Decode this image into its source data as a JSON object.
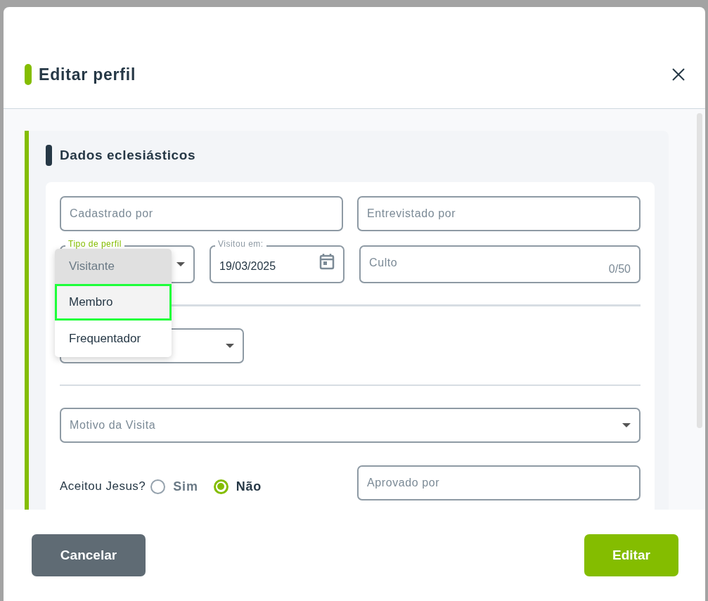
{
  "window": {
    "title": "Editar perfil"
  },
  "section": {
    "title": "Dados eclesiásticos"
  },
  "fields_row1": [
    {
      "placeholder": "Cadastrado por"
    },
    {
      "placeholder": "Entrevistado por"
    }
  ],
  "profile_type": {
    "label": "Tipo de perfil"
  },
  "visit_date": {
    "label": "Visitou em:",
    "value": "19/03/2025"
  },
  "service": {
    "placeholder": "Culto",
    "counter": "0/50"
  },
  "motive": {
    "placeholder": "Motivo da Visita"
  },
  "accepted_jesus": {
    "label": "Aceitou Jesus?",
    "options": [
      {
        "label": "Sim",
        "selected": false
      },
      {
        "label": "Não",
        "selected": true
      }
    ]
  },
  "approved_by": {
    "placeholder": "Aprovado por"
  },
  "menu": {
    "items": [
      {
        "label": "Visitante",
        "selected": true,
        "highlighted": false
      },
      {
        "label": "Membro",
        "selected": false,
        "highlighted": true
      },
      {
        "label": "Frequentador",
        "selected": false,
        "highlighted": false
      }
    ]
  },
  "buttons": {
    "cancel": "Cancelar",
    "submit": "Editar"
  }
}
